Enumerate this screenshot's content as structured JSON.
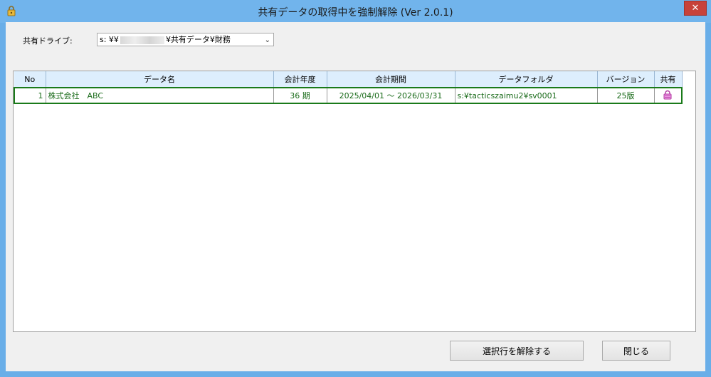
{
  "window": {
    "title": "共有データの取得中を強制解除 (Ver 2.0.1)",
    "close_label": "✕"
  },
  "drive": {
    "label": "共有ドライブ:",
    "prefix": "s: ¥¥",
    "suffix": "¥共有データ¥財務"
  },
  "table": {
    "headers": {
      "no": "No",
      "name": "データ名",
      "fiscal_year": "会計年度",
      "period": "会計期間",
      "folder": "データフォルダ",
      "version": "バージョン",
      "shared": "共有"
    },
    "rows": [
      {
        "no": "1",
        "name": "株式会社　ABC",
        "fiscal_year": "36 期",
        "period": "2025/04/01 ～ 2026/03/31",
        "folder": "s:¥tacticszaimu2¥sv0001",
        "version": "25版",
        "shared_icon": "lock-icon"
      }
    ]
  },
  "buttons": {
    "release": "選択行を解除する",
    "close": "閉じる"
  },
  "colors": {
    "titlebar": "#71b4ec",
    "row_text": "#1a6b1a",
    "row_border": "#1a7a1a",
    "header_bg": "#ddeefd",
    "lock": "#d14fc0"
  }
}
